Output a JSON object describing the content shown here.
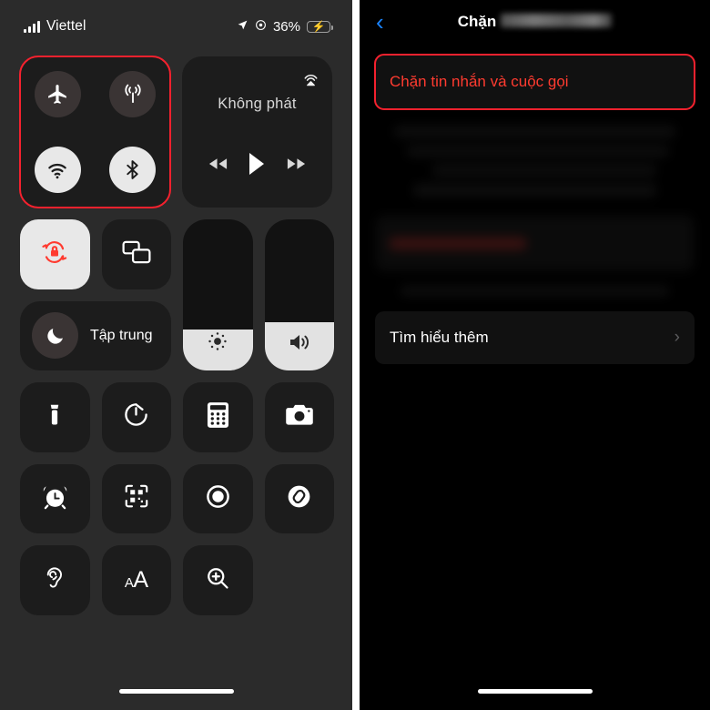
{
  "left_panel": {
    "name": "control-center",
    "status_bar": {
      "carrier": "Viettel",
      "signal_icon": "cellular-bars-icon",
      "location_icon": "location-arrow-icon",
      "focus_icon": "focus-indicator-icon",
      "battery_percent": "36%",
      "battery_fill": 62,
      "charging_icon": "lightning-bolt-icon",
      "battery_color": "#37c84a"
    },
    "connectivity": {
      "highlighted": true,
      "highlight_color": "#f4212e",
      "toggles": [
        {
          "name": "airplane-mode-toggle",
          "icon": "airplane-icon",
          "state": "off"
        },
        {
          "name": "cellular-data-toggle",
          "icon": "cellular-antenna-icon",
          "state": "off"
        },
        {
          "name": "wifi-toggle",
          "icon": "wifi-icon",
          "state": "on"
        },
        {
          "name": "bluetooth-toggle",
          "icon": "bluetooth-icon",
          "state": "on"
        }
      ]
    },
    "media": {
      "title": "Không phát",
      "airplay_icon": "airplay-audio-icon",
      "controls": [
        {
          "name": "rewind-button",
          "icon": "rewind-icon"
        },
        {
          "name": "play-button",
          "icon": "play-icon"
        },
        {
          "name": "forward-button",
          "icon": "fast-forward-icon"
        }
      ]
    },
    "quick_toggles": [
      {
        "name": "rotation-lock-toggle",
        "icon": "rotation-lock-icon",
        "state": "on",
        "icon_color": "#ff3b30"
      },
      {
        "name": "screen-mirroring-toggle",
        "icon": "screen-mirroring-icon",
        "state": "off"
      }
    ],
    "focus": {
      "label": "Tập trung",
      "icon": "moon-icon"
    },
    "sliders": [
      {
        "name": "brightness-slider",
        "icon": "brightness-icon",
        "value": 27
      },
      {
        "name": "volume-slider",
        "icon": "speaker-volume-icon",
        "value": 32
      }
    ],
    "shortcuts": [
      {
        "name": "flashlight-tile",
        "icon": "flashlight-icon"
      },
      {
        "name": "timer-tile",
        "icon": "timer-icon"
      },
      {
        "name": "calculator-tile",
        "icon": "calculator-icon"
      },
      {
        "name": "camera-tile",
        "icon": "camera-icon"
      },
      {
        "name": "alarm-tile",
        "icon": "alarm-clock-icon"
      },
      {
        "name": "qr-scanner-tile",
        "icon": "qr-code-icon"
      },
      {
        "name": "screen-record-tile",
        "icon": "screen-record-icon"
      },
      {
        "name": "shazam-tile",
        "icon": "shazam-icon"
      },
      {
        "name": "hearing-tile",
        "icon": "ear-hearing-icon"
      },
      {
        "name": "text-size-tile",
        "icon": "text-size-icon",
        "small_a": "A",
        "big_a": "A"
      },
      {
        "name": "magnifier-tile",
        "icon": "magnifier-icon"
      }
    ],
    "home_indicator": "home-indicator"
  },
  "right_panel": {
    "name": "block-contact-settings",
    "nav": {
      "back_icon": "back-chevron-icon",
      "back_color": "#1a84ff",
      "title": "Chặn",
      "redacted_name": true
    },
    "block_action": {
      "label": "Chặn tin nhắn và cuộc gọi",
      "text_color": "#ff3b30",
      "highlighted": true,
      "highlight_color": "#f4212e"
    },
    "blurred_content": {
      "redacted": true
    },
    "learn_more": {
      "label": "Tìm hiểu thêm",
      "chevron_icon": "chevron-right-icon"
    },
    "home_indicator": "home-indicator"
  }
}
